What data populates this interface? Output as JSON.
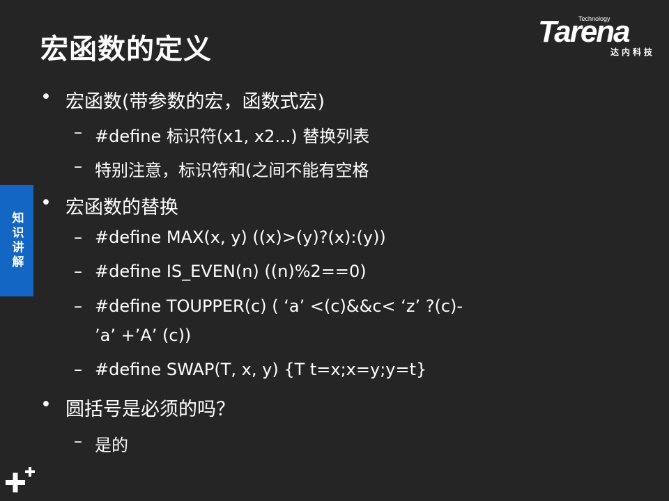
{
  "title": "宏函数的定义",
  "logo": {
    "small": "Technology",
    "word": "Tarena",
    "cn": "达内科技"
  },
  "side_tab": "知识讲解",
  "items": [
    {
      "level": 1,
      "marker": "•",
      "text": "宏函数(带参数的宏，函数式宏)"
    },
    {
      "level": 2,
      "marker": "–",
      "text": "#define 标识符(x1, x2...) 替换列表"
    },
    {
      "level": 2,
      "marker": "–",
      "text": "特别注意，标识符和(之间不能有空格"
    },
    {
      "level": 1,
      "marker": "•",
      "text": "宏函数的替换"
    },
    {
      "level": 2,
      "marker": "–",
      "text": "#define MAX(x, y)  ((x)>(y)?(x):(y))"
    },
    {
      "level": 2,
      "marker": "–",
      "text": "#define IS_EVEN(n) ((n)%2==0)"
    },
    {
      "level": 2,
      "marker": "–",
      "text": "#define TOUPPER(c) ( ‘a’ <(c)&&c< ‘z’ ?(c)-"
    },
    {
      "level": 2,
      "marker": "",
      "text": "’a’ +’A’ (c))"
    },
    {
      "level": 2,
      "marker": "–",
      "text": "#define SWAP(T, x, y)  {T t=x;x=y;y=t}"
    },
    {
      "level": 1,
      "marker": "•",
      "text": "圆括号是必须的吗？"
    },
    {
      "level": 2,
      "marker": "–",
      "text": "是的"
    }
  ]
}
